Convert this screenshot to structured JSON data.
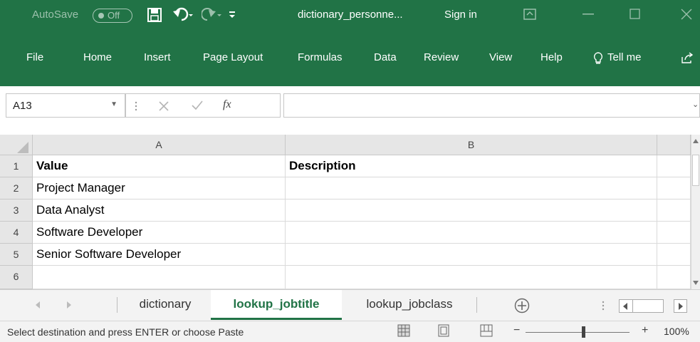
{
  "titlebar": {
    "autosave_label": "AutoSave",
    "autosave_state": "Off",
    "filename": "dictionary_personne...",
    "signin": "Sign in"
  },
  "ribbon": {
    "tabs": [
      "File",
      "Home",
      "Insert",
      "Page Layout",
      "Formulas",
      "Data",
      "Review",
      "View",
      "Help"
    ],
    "tellme": "Tell me"
  },
  "formula_bar": {
    "name_box": "A13",
    "fx_label": "fx",
    "formula": ""
  },
  "sheet": {
    "columns": [
      "A",
      "B"
    ],
    "rows": [
      {
        "num": "1",
        "a": "Value",
        "b": "Description",
        "bold": true
      },
      {
        "num": "2",
        "a": "Project Manager",
        "b": ""
      },
      {
        "num": "3",
        "a": "Data Analyst",
        "b": ""
      },
      {
        "num": "4",
        "a": "Software Developer",
        "b": ""
      },
      {
        "num": "5",
        "a": "Senior Software Developer",
        "b": ""
      },
      {
        "num": "6",
        "a": "",
        "b": ""
      }
    ]
  },
  "sheet_tabs": {
    "tabs": [
      "dictionary",
      "lookup_jobtitle",
      "lookup_jobclass"
    ],
    "active": "lookup_jobtitle"
  },
  "status_bar": {
    "message": "Select destination and press ENTER or choose Paste",
    "zoom": "100%",
    "minus": "−",
    "plus": "+"
  },
  "colors": {
    "accent": "#217346"
  }
}
